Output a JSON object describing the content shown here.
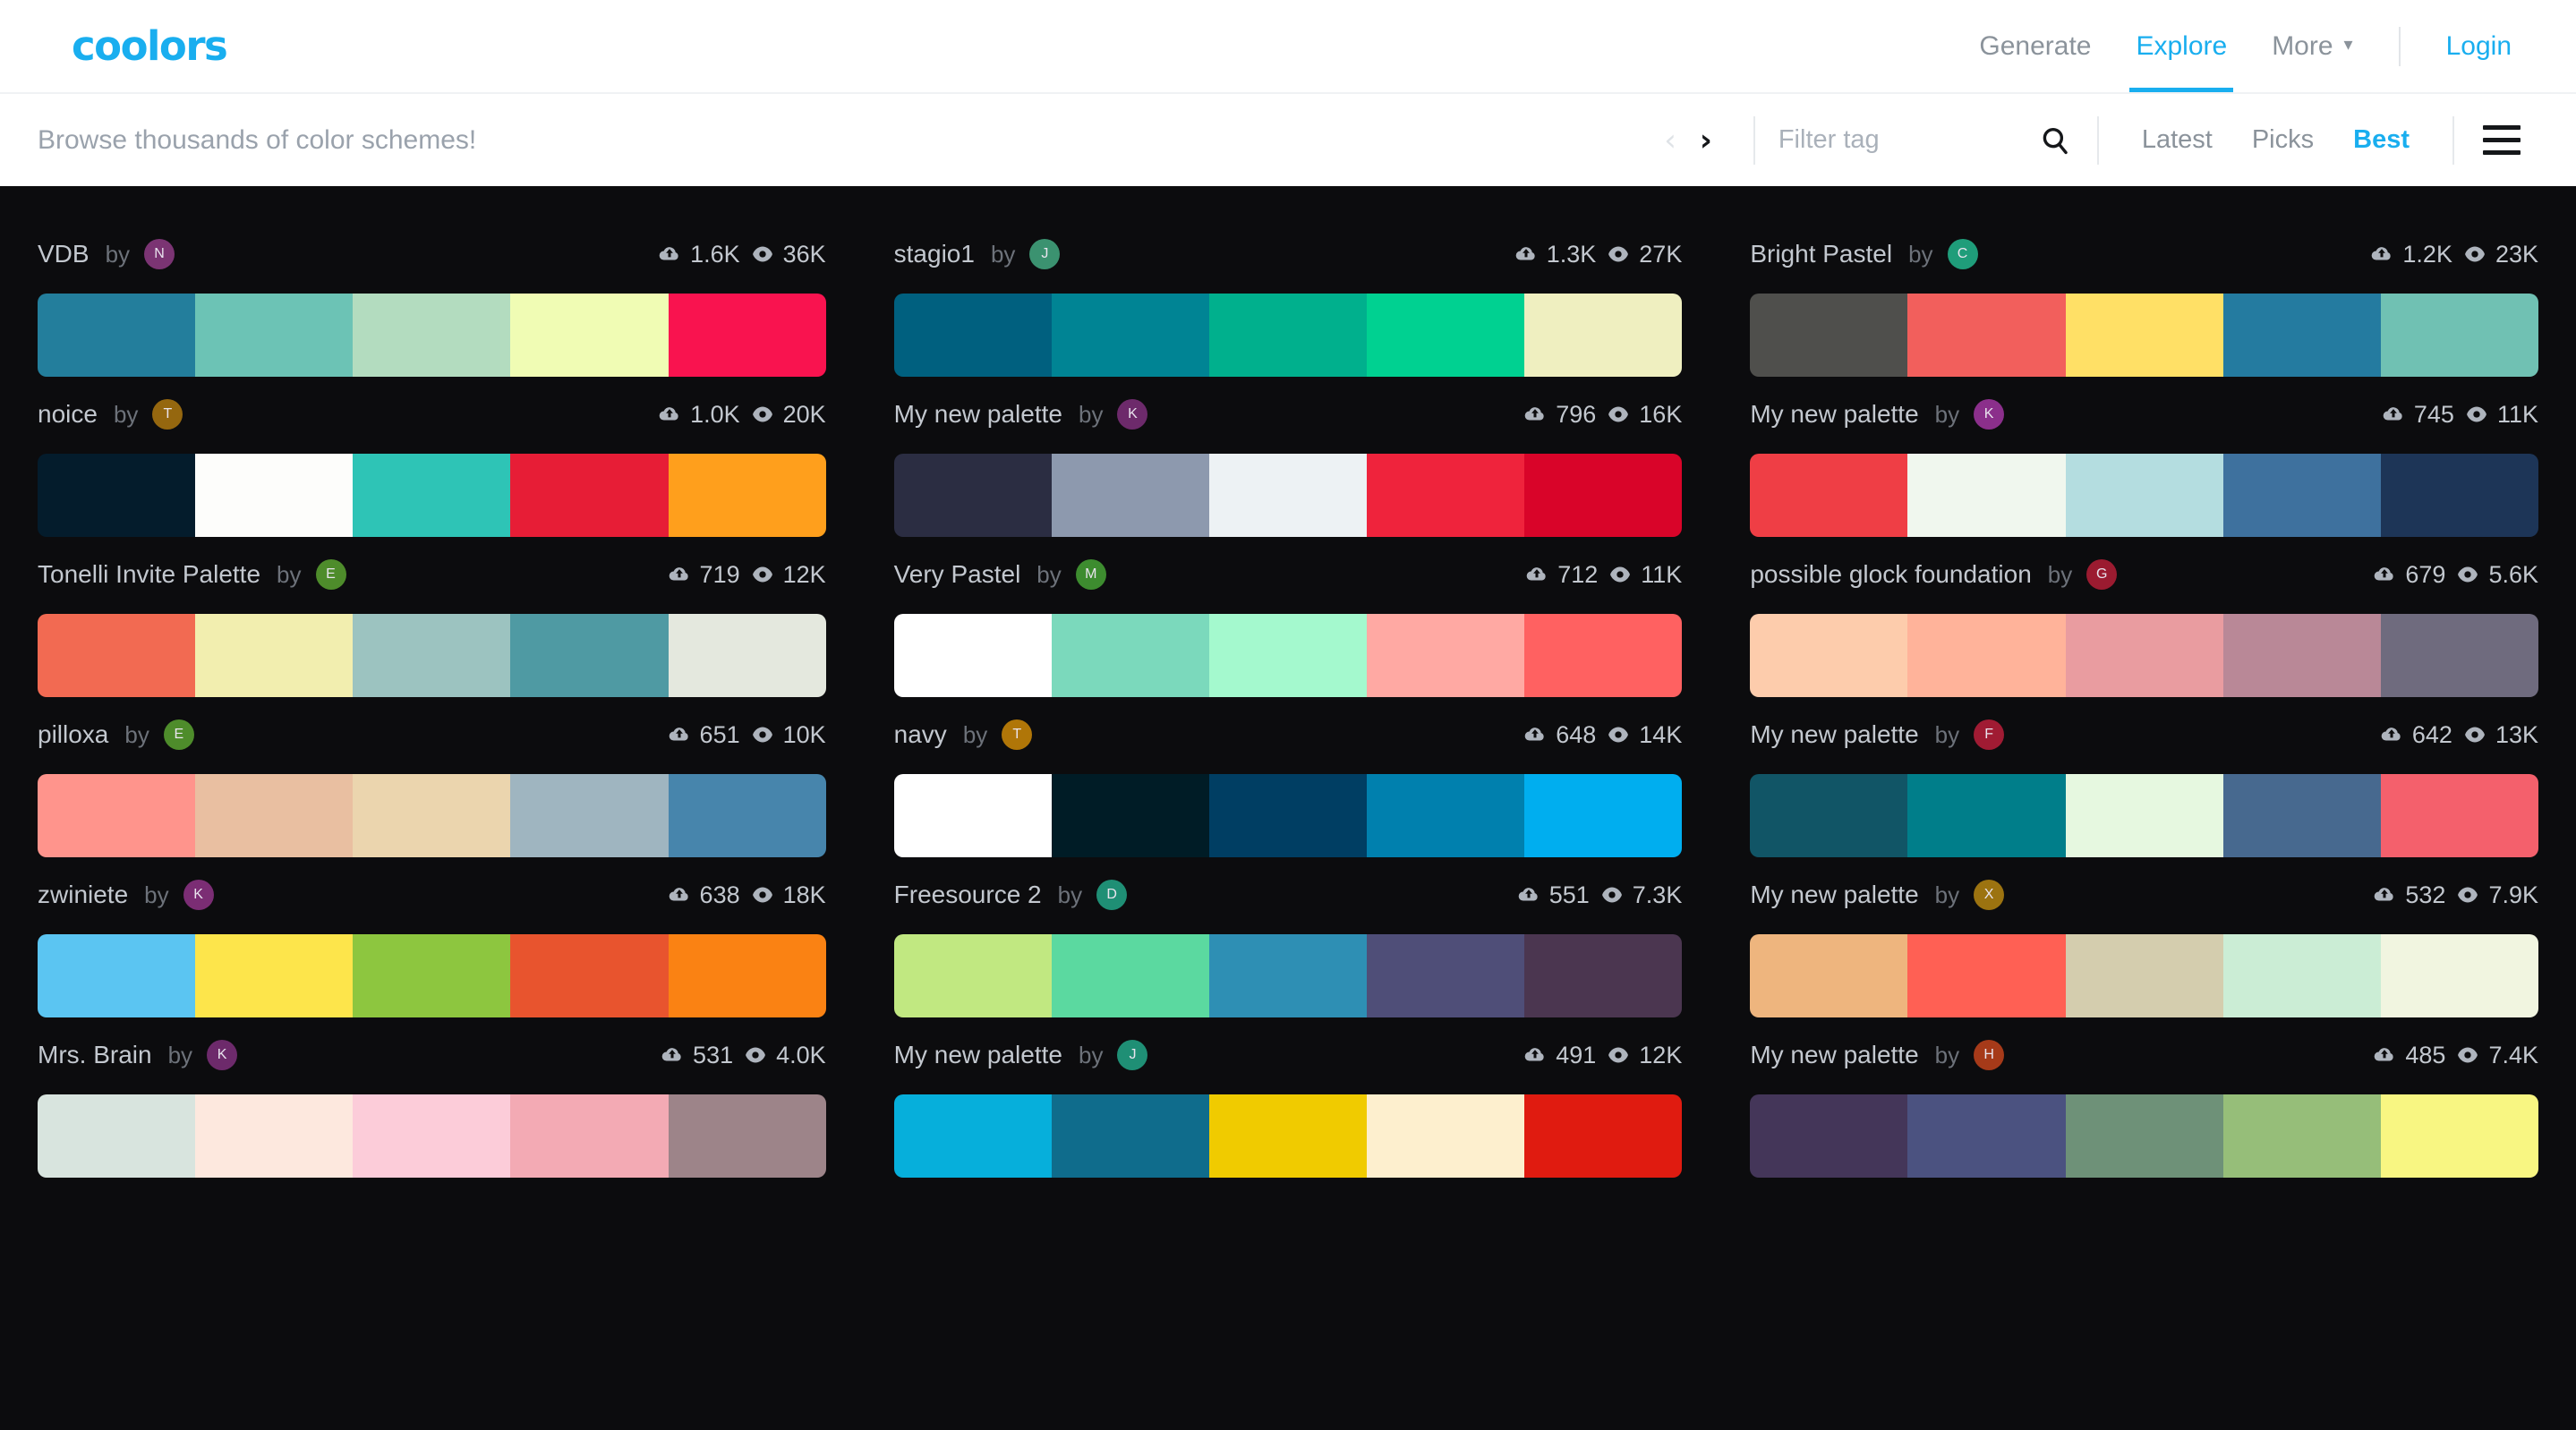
{
  "header": {
    "logo": "coolors",
    "nav": [
      {
        "label": "Generate",
        "active": false
      },
      {
        "label": "Explore",
        "active": true
      },
      {
        "label": "More",
        "active": false,
        "caret": "⌄"
      }
    ],
    "login": "Login"
  },
  "toolbar": {
    "browse_text": "Browse thousands of color schemes!",
    "prev_arrow": "‹",
    "next_arrow": "›",
    "filter_value": "",
    "filter_placeholder": "Filter tag",
    "sorts": [
      {
        "label": "Latest",
        "active": false
      },
      {
        "label": "Picks",
        "active": false
      },
      {
        "label": "Best",
        "active": true
      }
    ]
  },
  "colors": {
    "accent": "#19aeef",
    "page_bg": "#0c0c0e",
    "bar_bg": "#ffffff",
    "muted_text": "#8b939b",
    "card_text": "#c3c8cf"
  },
  "palettes": [
    {
      "name": "VDB",
      "by": "by",
      "author_initial": "N",
      "author_color": "#7b3473",
      "likes": "1.6K",
      "views": "36K",
      "swatches": [
        "#237e9c",
        "#6cc3b5",
        "#b3dcbf",
        "#f0fcb4",
        "#f9134f"
      ]
    },
    {
      "name": "stagio1",
      "by": "by",
      "author_initial": "J",
      "author_color": "#3b9270",
      "likes": "1.3K",
      "views": "27K",
      "swatches": [
        "#00607f",
        "#008494",
        "#00b08d",
        "#00d191",
        "#efefc0"
      ]
    },
    {
      "name": "Bright Pastel",
      "by": "by",
      "author_initial": "c",
      "author_color": "#1f9d7a",
      "likes": "1.2K",
      "views": "23K",
      "swatches": [
        "#4f4f4c",
        "#f25f5c",
        "#ffe066",
        "#247ba0",
        "#70c1b3"
      ]
    },
    {
      "name": "noice",
      "by": "by",
      "author_initial": "T",
      "author_color": "#95670f",
      "likes": "1.0K",
      "views": "20K",
      "swatches": [
        "#041c2c",
        "#fdfdfb",
        "#2ec4b6",
        "#e71d36",
        "#ff9f1c"
      ]
    },
    {
      "name": "My new palette",
      "by": "by",
      "author_initial": "K",
      "author_color": "#6d2a6b",
      "likes": "796",
      "views": "16K",
      "swatches": [
        "#2b2d42",
        "#8d99ae",
        "#edf2f4",
        "#ef233c",
        "#d90429"
      ]
    },
    {
      "name": "My new palette",
      "by": "by",
      "author_initial": "K",
      "author_color": "#8b2f8b",
      "likes": "745",
      "views": "11K",
      "swatches": [
        "#ef3e45",
        "#f0f7ee",
        "#b4dde0",
        "#3e719e",
        "#1d3557"
      ]
    },
    {
      "name": "Tonelli Invite Palette",
      "by": "by",
      "author_initial": "E",
      "author_color": "#4e8c2b",
      "likes": "719",
      "views": "12K",
      "swatches": [
        "#f26a52",
        "#f2eeaf",
        "#9cc3c0",
        "#4f9aa3",
        "#e4e8de"
      ]
    },
    {
      "name": "Very Pastel",
      "by": "by",
      "author_initial": "M",
      "author_color": "#3d8c2f",
      "likes": "712",
      "views": "11K",
      "swatches": [
        "#ffffff",
        "#7bd9bc",
        "#a4f9ce",
        "#ffa9a3",
        "#ff6161"
      ]
    },
    {
      "name": "possible glock foundation",
      "by": "by",
      "author_initial": "G",
      "author_color": "#9b1b30",
      "likes": "679",
      "views": "5.6K",
      "swatches": [
        "#fdccac",
        "#ffb39a",
        "#e99ca0",
        "#b98897",
        "#6f6b7e"
      ]
    },
    {
      "name": "pilloxa",
      "by": "by",
      "author_initial": "E",
      "author_color": "#4e8c2b",
      "likes": "651",
      "views": "10K",
      "swatches": [
        "#ff948c",
        "#e9bfa1",
        "#ebd5ae",
        "#9fb5c0",
        "#4785ac"
      ]
    },
    {
      "name": "navy",
      "by": "by",
      "author_initial": "T",
      "author_color": "#b07608",
      "likes": "648",
      "views": "14K",
      "swatches": [
        "#ffffff",
        "#001c26",
        "#003e63",
        "#0080ae",
        "#00aeef"
      ]
    },
    {
      "name": "My new palette",
      "by": "by",
      "author_initial": "F",
      "author_color": "#a01b33",
      "likes": "642",
      "views": "13K",
      "swatches": [
        "#115566",
        "#007e8a",
        "#e6f8e0",
        "#47698f",
        "#f4606c"
      ]
    },
    {
      "name": "zwiniete",
      "by": "by",
      "author_initial": "K",
      "author_color": "#7b2d74",
      "likes": "638",
      "views": "18K",
      "swatches": [
        "#5bc5f2",
        "#fde54b",
        "#8dc63f",
        "#e8542e",
        "#fa8213"
      ]
    },
    {
      "name": "Freesource 2",
      "by": "by",
      "author_initial": "D",
      "author_color": "#1f8f75",
      "likes": "551",
      "views": "7.3K",
      "swatches": [
        "#c1e881",
        "#5bd9a0",
        "#2e8fb4",
        "#4f4e78",
        "#4b3650"
      ]
    },
    {
      "name": "My new palette",
      "by": "by",
      "author_initial": "X",
      "author_color": "#9c7310",
      "likes": "532",
      "views": "7.9K",
      "swatches": [
        "#eeb57e",
        "#ff6054",
        "#d4cdae",
        "#cbedd5",
        "#f1f5e0"
      ]
    },
    {
      "name": "Mrs. Brain",
      "by": "by",
      "author_initial": "K",
      "author_color": "#6d2a6b",
      "likes": "531",
      "views": "4.0K",
      "swatches": [
        "#d8e4de",
        "#fde8de",
        "#fcccd9",
        "#f3aab4",
        "#9d8489"
      ]
    },
    {
      "name": "My new palette",
      "by": "by",
      "author_initial": "J",
      "author_color": "#1f8f75",
      "likes": "491",
      "views": "12K",
      "swatches": [
        "#06afdb",
        "#0f6c8c",
        "#f0cb00",
        "#fdefce",
        "#e01b10"
      ]
    },
    {
      "name": "My new palette",
      "by": "by",
      "author_initial": "H",
      "author_color": "#a63a19",
      "likes": "485",
      "views": "7.4K",
      "swatches": [
        "#443659",
        "#4b5280",
        "#6e9178",
        "#96be79",
        "#f8f682"
      ]
    }
  ],
  "icons": {
    "likes": "cloud-up-icon",
    "views": "eye-icon",
    "search": "search-icon",
    "menu": "hamburger-icon"
  }
}
